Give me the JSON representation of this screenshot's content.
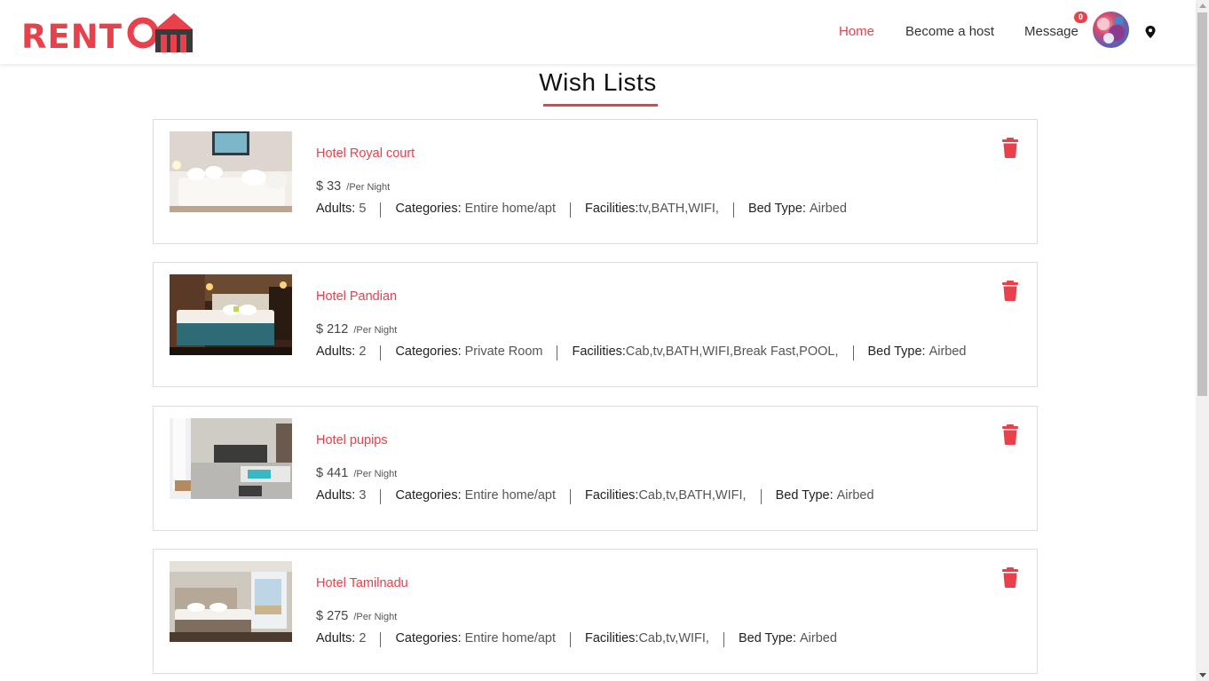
{
  "brand": {
    "logo_text": "RENT",
    "accent_color": "#e8414b"
  },
  "nav": {
    "home": "Home",
    "become_host": "Become a host",
    "message": "Message",
    "message_count": "0"
  },
  "page": {
    "title": "Wish Lists"
  },
  "labels": {
    "per_night": "/Per Night",
    "adults": "Adults:",
    "categories": "Categories:",
    "facilities": "Facilities:",
    "bed_type": "Bed Type:",
    "currency": "$"
  },
  "wishlist": [
    {
      "name": "Hotel Royal court",
      "price": "33",
      "adults": "5",
      "category": "Entire home/apt",
      "facilities": "tv,BATH,WIFI,",
      "bed_type": "Airbed"
    },
    {
      "name": "Hotel Pandian",
      "price": "212",
      "adults": "2",
      "category": "Private Room",
      "facilities": "Cab,tv,BATH,WIFI,Break Fast,POOL,",
      "bed_type": "Airbed"
    },
    {
      "name": "Hotel pupips",
      "price": "441",
      "adults": "3",
      "category": "Entire home/apt",
      "facilities": "Cab,tv,BATH,WIFI,",
      "bed_type": "Airbed"
    },
    {
      "name": "Hotel Tamilnadu",
      "price": "275",
      "adults": "2",
      "category": "Entire home/apt",
      "facilities": "Cab,tv,WIFI,",
      "bed_type": "Airbed"
    }
  ]
}
